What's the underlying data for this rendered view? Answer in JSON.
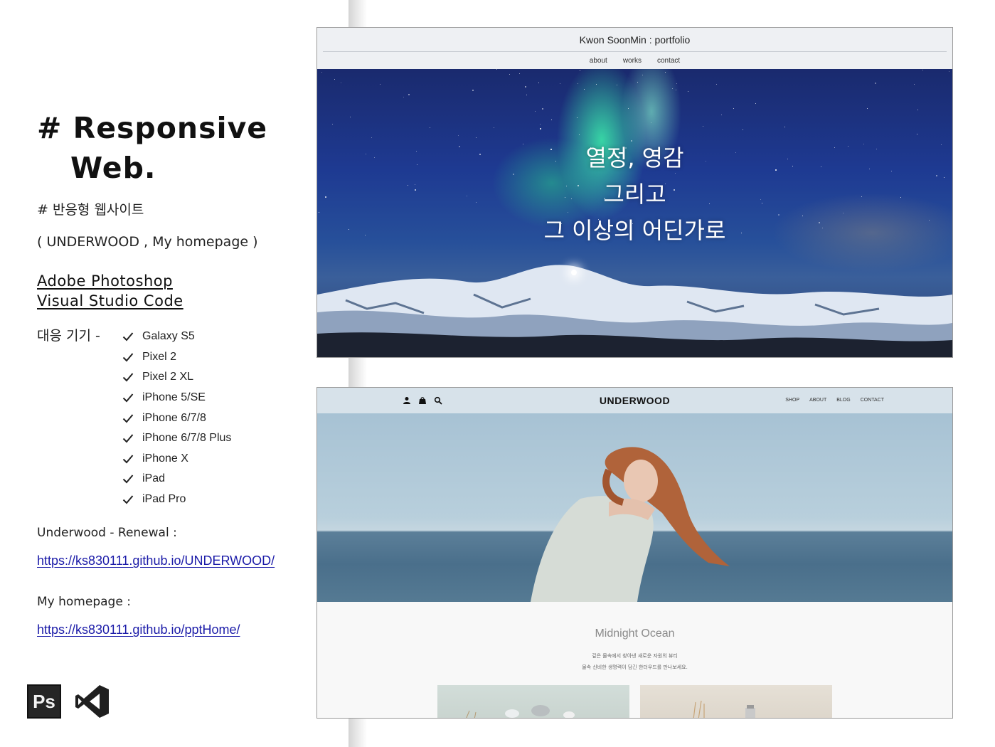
{
  "left": {
    "title_line1": "# Responsive",
    "title_line2": "Web.",
    "subtitle": "# 반응형 웹사이트",
    "projects": "( UNDERWOOD , My homepage )",
    "tools": [
      "Adobe Photoshop",
      "Visual Studio Code"
    ],
    "devices_label": "대응 기기 -",
    "devices": [
      "Galaxy S5",
      "Pixel 2",
      "Pixel 2 XL",
      "iPhone 5/SE",
      "iPhone 6/7/8",
      "iPhone 6/7/8 Plus",
      "iPhone X",
      "iPad",
      "iPad Pro"
    ],
    "underwood_label": "Underwood - Renewal :",
    "underwood_link": "https://ks830111.github.io/UNDERWOOD/",
    "home_label": "My homepage :",
    "home_link": "https://ks830111.github.io/pptHome/",
    "app_icons": [
      {
        "name": "photoshop-icon",
        "text": "Ps"
      },
      {
        "name": "visual-studio-code-icon",
        "text": ""
      }
    ]
  },
  "portfolio": {
    "title": "Kwon SoonMin : portfolio",
    "nav": [
      "about",
      "works",
      "contact"
    ],
    "hero_lines": [
      "열정, 영감",
      "그리고",
      "그 이상의 어딘가로"
    ]
  },
  "underwood": {
    "logo": "UNDERWOOD",
    "icons": [
      "user-icon",
      "bag-icon",
      "search-icon"
    ],
    "nav": [
      "SHOP",
      "ABOUT",
      "BLOG",
      "CONTACT"
    ],
    "section_title": "Midnight Ocean",
    "desc_lines": [
      "깊은 물속에서 찾아낸 새로운 자원의 뷰티",
      "물속 신비한 생명력이 담긴 한더우드를 만나보세요."
    ]
  },
  "colors": {
    "link": "#1a1aa8",
    "portfolio_header": "#eef0f3",
    "underwood_header": "#d7e2ea"
  }
}
